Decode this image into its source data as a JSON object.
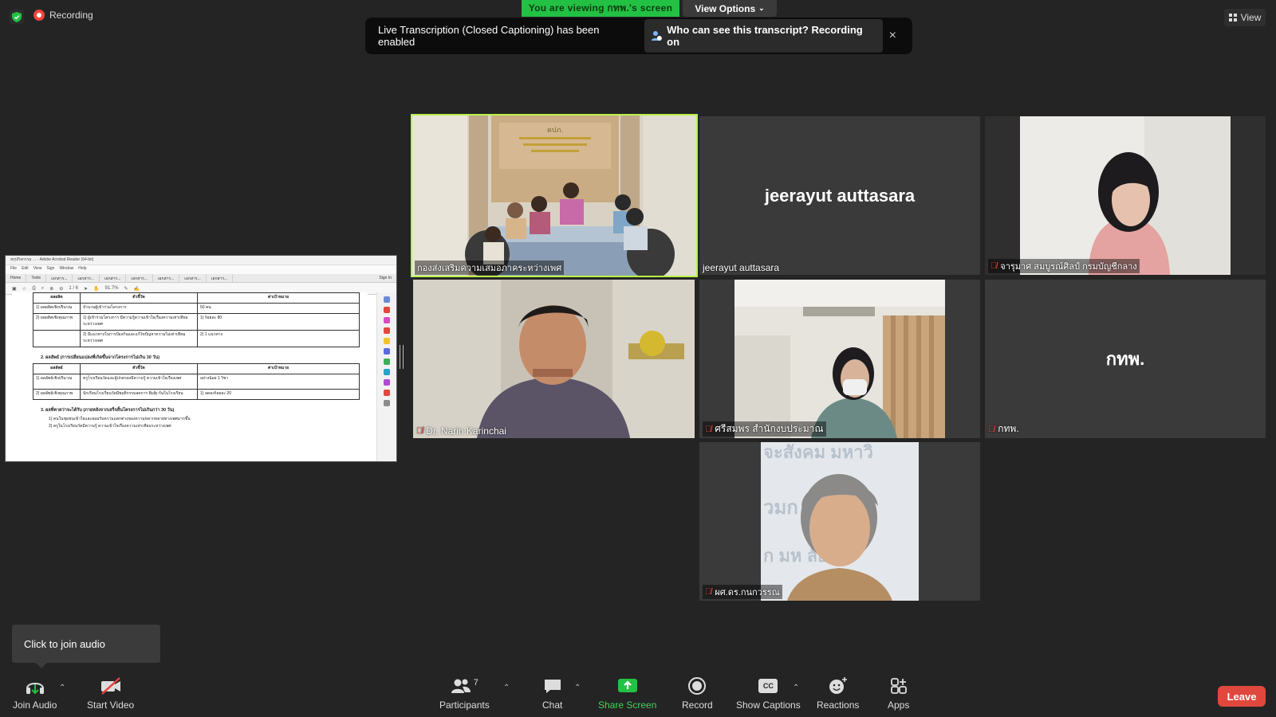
{
  "top": {
    "recording_label": "Recording",
    "viewing_label": "You are viewing กทพ.'s screen",
    "view_options_label": "View Options",
    "view_label": "View"
  },
  "banner": {
    "message": "Live Transcription (Closed Captioning) has been enabled",
    "link_label": "Who can see this transcript? Recording on",
    "close_glyph": "×"
  },
  "shared_doc": {
    "title_bar": "สรุปกิจกรรม ... - Adobe Acrobat Reader (64-bit)",
    "menu": [
      "File",
      "Edit",
      "View",
      "Sign",
      "Window",
      "Help"
    ],
    "tabs": [
      "Home",
      "Tools",
      "เอกสาร...",
      "เอกสาร...",
      "เอกสาร...",
      "เอกสาร...",
      "เอกสาร...",
      "เอกสาร...",
      "เอกสาร...",
      "Sign In"
    ],
    "page_indicator": "1 / 6",
    "zoom": "91.7%",
    "table1_header": [
      "ผลผลิต",
      "ตัวชี้วัด",
      "ค่าเป้าหมาย"
    ],
    "table1_rows": [
      [
        "1) ผลผลิตเชิงปริมาณ",
        "จำนวนผู้เข้าร่วมโครงการ",
        "50 คน"
      ],
      [
        "2) ผลผลิตเชิงคุณภาพ",
        "1) ผู้เข้าร่วมโครงการ มีความรู้ความเข้าใจเรื่องความเท่าเทียมระหว่างเพศ",
        "1) ร้อยละ 80"
      ],
      [
        "",
        "2) มีแนวทางในการป้องกันและแก้ไขปัญหาความไม่เท่าเทียมระหว่างเพศ",
        "2) 1 แนวทาง"
      ]
    ],
    "section2": "2. ผลลัพธ์ (การเปลี่ยนแปลงที่เกิดขึ้นจากโครงการไม่เกิน 30 วัน)",
    "table2_header": [
      "ผลลัพธ์",
      "ตัวชี้วัด",
      "ค่าเป้าหมาย"
    ],
    "table2_rows": [
      [
        "1) ผลลัพธ์เชิงปริมาณ",
        "ครูโรงเรียนวัดและผู้ปกครองมีความรู้ ความเข้าใจเรื่องเพศ",
        "อย่างน้อย 1 วิชา"
      ],
      [
        "2) ผลลัพธ์เชิงคุณภาพ",
        "นักเรียนโรงเรียนวัดมีพฤติกรรมลดการ Bully กันในโรงเรียน",
        "1) ลดลงร้อยละ 20"
      ]
    ],
    "section3": "3. ผลที่คาดว่าจะได้รับ (ภายหลังจากเสร็จสิ้นโครงการไม่เกินกว่า 30 วัน)",
    "bullets": [
      "1) คนในชุมชนเข้าใจและยอมรับความแตกต่างของความหลากหลายทางเพศมากขึ้น",
      "2) ครูในโรงเรียนวัดมีความรู้ ความเข้าใจเรื่องความเท่าเทียมระหว่างเพศ"
    ]
  },
  "tiles": {
    "t1_name": "กองส่งเสริมความเสมอภาคระหว่างเพศ",
    "t1_wall_text": "คปภ.",
    "t2_name": "jeerayut auttasara",
    "t2_big": "jeerayut auttasara",
    "t3_name": "จารุมาศ สมบูรณ์ศิลป์ กรมบัญชีกลาง",
    "t4_name": "Dr. Narin Karinchai",
    "t5_name": "ศรีสมพร สำนักงบประมาณ",
    "t6_name": "กทพ.",
    "t6_big": "กทพ.",
    "t7_name": "ผศ.ดร.กนกวรรณ",
    "t7_sign_top": "จะสังคม มหาวิ",
    "t7_sign_mid": "วมก",
    "t7_sign_bot": "ก มห    ลัย"
  },
  "toolbar": {
    "tooltip": "Click to join audio",
    "join_audio": "Join Audio",
    "start_video": "Start Video",
    "participants": "Participants",
    "participants_count": "7",
    "chat": "Chat",
    "share_screen": "Share Screen",
    "record": "Record",
    "show_captions": "Show Captions",
    "reactions": "Reactions",
    "apps": "Apps",
    "leave": "Leave",
    "cc_text": "CC"
  },
  "colors": {
    "background": "#242424",
    "viewing_green": "#23c143",
    "active_speaker": "#b9f24a",
    "leave_red": "#e0483e",
    "muted_red": "#e8403a"
  }
}
